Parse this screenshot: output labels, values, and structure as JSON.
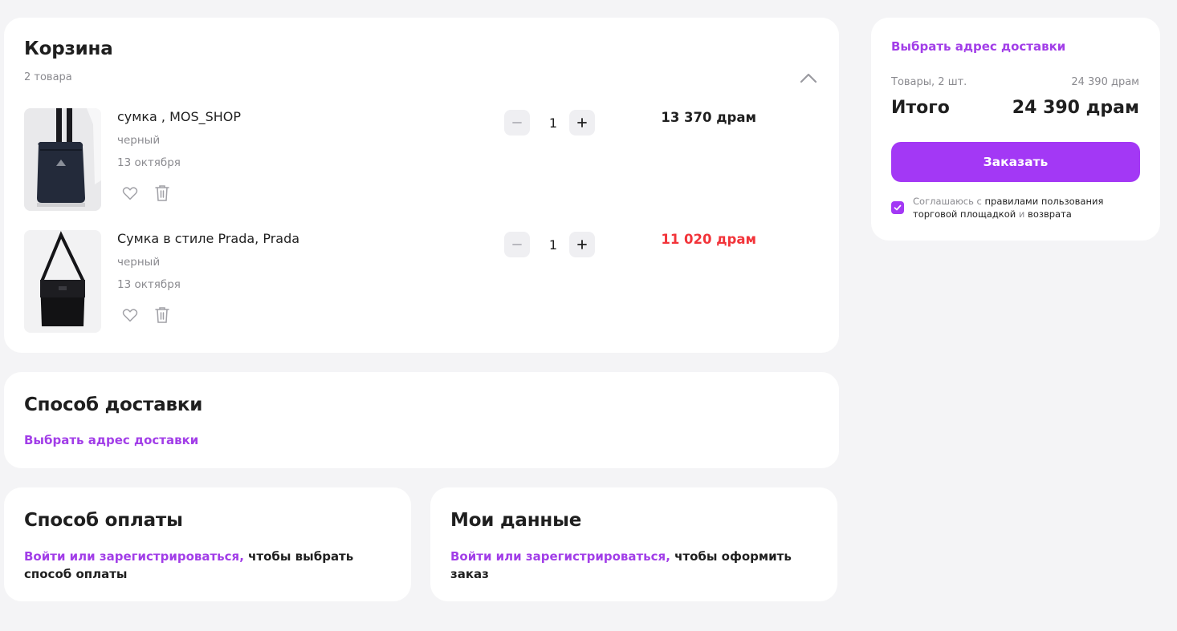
{
  "cart": {
    "title": "Корзина",
    "count": "2 товара",
    "items": [
      {
        "name": "сумка , MOS_SHOP",
        "color": "черный",
        "date": "13 октября",
        "qty": "1",
        "price": "13 370 драм",
        "price_color": "#1f1f1f"
      },
      {
        "name": "Сумка в стиле Prada, Prada",
        "color": "черный",
        "date": "13 октября",
        "qty": "1",
        "price": "11 020 драм",
        "price_color": "#f2343a"
      }
    ],
    "icons": {
      "collapse": "chevron-up-icon",
      "favorite": "heart-icon",
      "delete": "trash-icon",
      "minus": "minus-icon",
      "plus": "plus-icon"
    }
  },
  "delivery": {
    "title": "Способ доставки",
    "link": "Выбрать адрес доставки"
  },
  "payment": {
    "title": "Способ оплаты",
    "link": "Войти или зарегистрироваться,",
    "text": " чтобы выбрать способ оплаты"
  },
  "mydata": {
    "title": "Мои данные",
    "link": "Войти или зарегистрироваться,",
    "text": " чтобы оформить заказ"
  },
  "summary": {
    "address_link": "Выбрать адрес доставки",
    "goods_label": "Товары, 2 шт.",
    "goods_value": "24 390 драм",
    "total_label": "Итого",
    "total_value": "24 390 драм",
    "order_button": "Заказать",
    "agree_prefix": "Соглашаюсь с ",
    "agree_rules": "правилами пользования торговой площадкой",
    "agree_and": " и ",
    "agree_return": "возврата",
    "agree_checked": true
  },
  "colors": {
    "accent": "#a338f5",
    "link": "#a23ee8",
    "price_red": "#f2343a",
    "background": "#f4f4f6"
  }
}
